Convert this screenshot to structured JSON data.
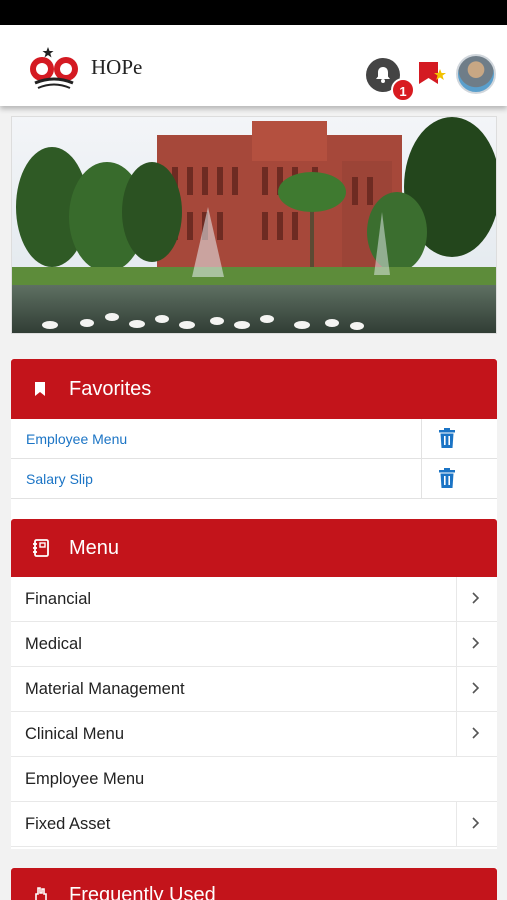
{
  "app": {
    "name": "HOPe"
  },
  "notifications": {
    "count": "1"
  },
  "favorites": {
    "title": "Favorites",
    "items": [
      {
        "label": "Employee Menu"
      },
      {
        "label": "Salary Slip"
      }
    ]
  },
  "menu": {
    "title": "Menu",
    "items": [
      {
        "label": "Financial",
        "has_chevron": true
      },
      {
        "label": "Medical",
        "has_chevron": true
      },
      {
        "label": "Material Management",
        "has_chevron": true
      },
      {
        "label": "Clinical Menu",
        "has_chevron": true
      },
      {
        "label": "Employee Menu",
        "has_chevron": false
      },
      {
        "label": "Fixed Asset",
        "has_chevron": true
      }
    ]
  },
  "frequently_used": {
    "title": "Frequently Used"
  },
  "icons": {
    "notification": "bell-icon",
    "bookmarks": "flag-star-icon",
    "favorites_header": "bookmark-icon",
    "menu_header": "notebook-icon",
    "delete": "trash-icon",
    "expand": "chevron-right-icon",
    "frequently_used_header": "hand-icon"
  },
  "colors": {
    "brand_red": "#c3141b",
    "link_blue": "#1b74c5",
    "badge_red": "#d81b20"
  }
}
